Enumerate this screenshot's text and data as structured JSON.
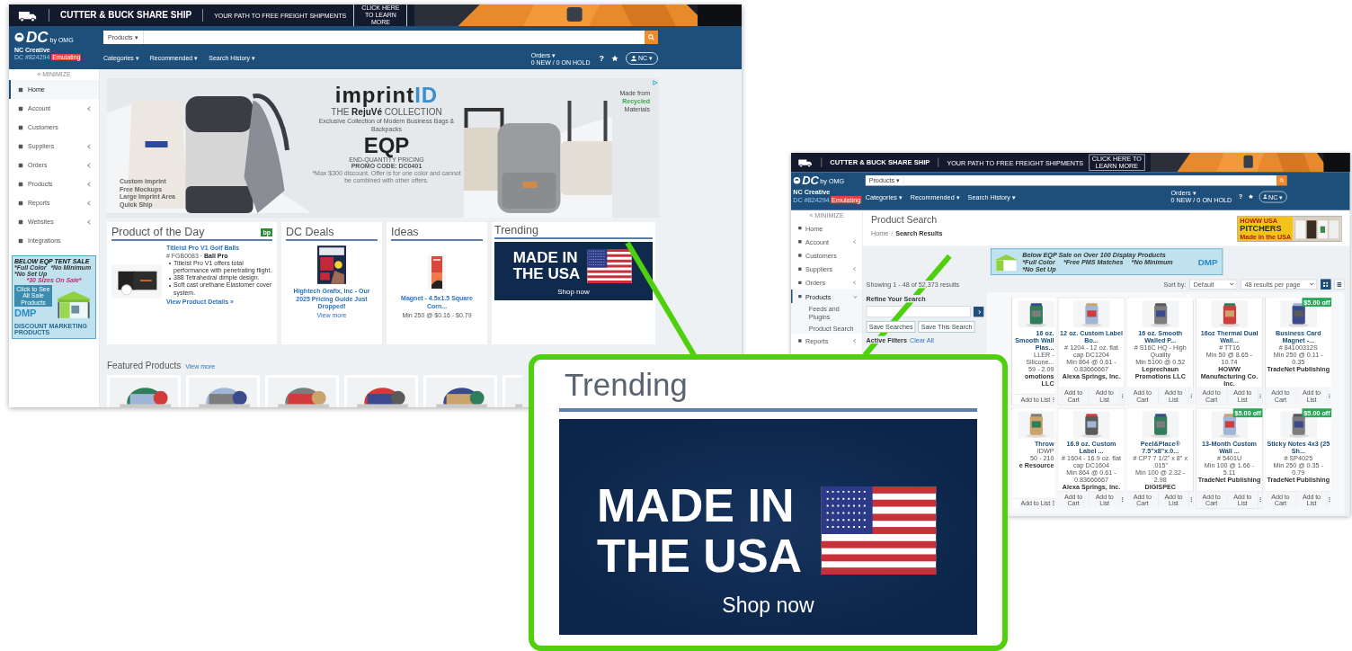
{
  "windows": [
    {
      "kind": "dashboard",
      "promo": {
        "title": "CUTTER & BUCK SHARE SHIP",
        "tagline": "YOUR PATH TO FREE FREIGHT SHIPMENTS",
        "button": "CLICK HERE TO LEARN MORE"
      },
      "header": {
        "logo": "DC",
        "logo_suffix": "by OMG",
        "company": "NC Creative",
        "account": "DC #824294",
        "badge": "Emulating",
        "search_scope": "Products ▾",
        "nav": [
          "Categories ▾",
          "Recommended ▾",
          "Search History ▾"
        ],
        "orders": "Orders ▾",
        "orders_status": "0 NEW / 0 ON HOLD",
        "help": "?",
        "user": "NC ▾"
      },
      "sidebar": {
        "minimize": "« MINIMIZE",
        "items": [
          {
            "label": "Home",
            "selected": true,
            "expandable": false,
            "expanded": false
          },
          {
            "label": "Account",
            "selected": false,
            "expandable": true,
            "expanded": false
          },
          {
            "label": "Customers",
            "selected": false,
            "expandable": false,
            "expanded": false
          },
          {
            "label": "Suppliers",
            "selected": false,
            "expandable": true,
            "expanded": false
          },
          {
            "label": "Orders",
            "selected": false,
            "expandable": true,
            "expanded": false
          },
          {
            "label": "Products",
            "selected": false,
            "expandable": true,
            "expanded": false
          },
          {
            "label": "Reports",
            "selected": false,
            "expandable": true,
            "expanded": false
          },
          {
            "label": "Websites",
            "selected": false,
            "expandable": true,
            "expanded": false
          },
          {
            "label": "Integrations",
            "selected": false,
            "expandable": false,
            "expanded": false
          }
        ],
        "ad": {
          "title": "BELOW EQP TENT SALE",
          "features": [
            "*Full Color",
            "*No Minimum",
            "*No Set Up"
          ],
          "highlight": "*30 Sizes On Sale*",
          "button": "Click to See All Sale Products",
          "brand": "DMP",
          "brand_full": "DISCOUNT MARKETING PRODUCTS"
        }
      },
      "hero": {
        "features": [
          "Custom Imprint",
          "Free Mockups",
          "Large Imprint Area",
          "Quick Ship"
        ],
        "brand": "imprint",
        "brand_mark": "ID",
        "collection": "THE **RejuVé** COLLECTION",
        "tagline": "Exclusive Collection of Modern Business Bags & Backpacks",
        "eqp": "EQP",
        "pricing": "END-QUANTITY PRICING",
        "promo": "PROMO CODE: DC0401",
        "fine_print": "*Max $300 discount. Offer is for one color and cannot be combined with other offers.",
        "recycled": "Made from **Recycled** Materials"
      },
      "potd": {
        "title": "Product of the Day",
        "badge": "bp",
        "product": "Titleist Pro V1 Golf Balls",
        "sku": "# FGB0083 · **Ball Pro**",
        "bullets": [
          "Titleist Pro V1 offers total performance with penetrating flight.",
          "388 Tetrahedral dimple design.",
          "Soft cast urethane Elastomer cover system."
        ],
        "link": "View Product Details »"
      },
      "deals": {
        "title": "DC Deals",
        "link": "Hightech Grafix, Inc - Our 2025 Pricing Guide Just Dropped!",
        "more": "View more"
      },
      "ideas": {
        "title": "Ideas",
        "product": "Magnet - 4.5x1.5 Square Corn...",
        "price": "Min 250 @ $0.16 - $0.79"
      },
      "trending": {
        "title": "Trending",
        "headline": [
          "MADE IN",
          "THE USA"
        ],
        "cta": "Shop now"
      },
      "featured": {
        "title": "Featured Products",
        "link": "View more",
        "cards": [
          {
            "kind": "picture"
          },
          {
            "kind": "picture"
          },
          {
            "kind": "picture"
          },
          {
            "kind": "picture"
          },
          {
            "kind": "picture"
          },
          {
            "kind": "clipped"
          }
        ]
      }
    },
    {
      "kind": "search",
      "promo": {
        "title": "CUTTER & BUCK SHARE SHIP",
        "tagline": "YOUR PATH TO FREE FREIGHT SHIPMENTS",
        "button": "CLICK HERE TO LEARN MORE"
      },
      "header": {
        "logo": "DC",
        "logo_suffix": "by OMG",
        "company": "NC Creative",
        "account": "DC #824294",
        "badge": "Emulating",
        "search_scope": "Products ▾",
        "nav": [
          "Categories ▾",
          "Recommended ▾",
          "Search History ▾"
        ],
        "orders": "Orders ▾",
        "orders_status": "0 NEW / 0 ON HOLD",
        "help": "?",
        "user": "NC ▾"
      },
      "sidebar": {
        "minimize": "« MINIMIZE",
        "items": [
          {
            "label": "Home",
            "selected": false,
            "expandable": false,
            "expanded": false
          },
          {
            "label": "Account",
            "selected": false,
            "expandable": true,
            "expanded": false
          },
          {
            "label": "Customers",
            "selected": false,
            "expandable": false,
            "expanded": false
          },
          {
            "label": "Suppliers",
            "selected": false,
            "expandable": true,
            "expanded": false
          },
          {
            "label": "Orders",
            "selected": false,
            "expandable": true,
            "expanded": false
          },
          {
            "label": "Products",
            "selected": true,
            "expandable": true,
            "expanded": true,
            "children": [
              "Feeds and Plugins",
              "Product Search"
            ]
          },
          {
            "label": "Reports",
            "selected": false,
            "expandable": true,
            "expanded": false
          }
        ]
      },
      "page": {
        "title": "Product Search",
        "breadcrumb": [
          "Home",
          "Search Results"
        ],
        "breadcrumb_separator": "/"
      },
      "top_ad": {
        "lines": [
          "HOWW USA",
          "PITCHERS",
          "Made in the USA"
        ]
      },
      "center_ad": {
        "title": "Below EQP Sale on Over 100 Display Products",
        "features": [
          "*Full Color",
          "*Free PMS Matches",
          "*No Minimum",
          "*No Set Up"
        ],
        "brand": "DMP"
      },
      "results": {
        "count": "Showing 1 - 48 of 52,373 results",
        "sort_label": "Sort by:",
        "sort": "Default",
        "per_page": "48 results per page",
        "views": [
          {
            "kind": "grid",
            "selected": true
          },
          {
            "kind": "list",
            "selected": false
          }
        ]
      },
      "refine": {
        "title": "Refine Your Search",
        "buttons": [
          "Save Searches",
          "Save This Search"
        ],
        "filters": "Active Filters",
        "clear": "Clear All"
      },
      "products": [
        {
          "kind": "clipped",
          "title": "16 oz. Smooth Wall Plas...",
          "lines": [
            "LLER - Silicone...",
            "59 - 2.09",
            "omotions LLC"
          ],
          "actions": [
            "Add to List"
          ]
        },
        {
          "kind": "full",
          "title": "12 oz. Custom Label Bo...",
          "lines": [
            "# 1204 - 12 oz. flat cap DC1204",
            "Min 864 @ 0.61 - 0.83666667",
            "Alexa Springs, Inc."
          ],
          "actions": [
            "Add to Cart",
            "Add to List"
          ]
        },
        {
          "kind": "full",
          "title": "16 oz. Smooth Walled P...",
          "lines": [
            "# S16C HQ - High Quality",
            "Min 5100 @ 0.52",
            "Leprechaun Promotions LLC"
          ],
          "actions": [
            "Add to Cart",
            "Add to List"
          ]
        },
        {
          "kind": "full",
          "title": "16oz Thermal Dual Wall...",
          "lines": [
            "# TT16",
            "Min 50 @ 8.65 - 10.74",
            "HOWW Manufacturing Co. Inc."
          ],
          "actions": [
            "Add to Cart",
            "Add to List"
          ]
        },
        {
          "kind": "full",
          "title": "Business Card Magnet -...",
          "lines": [
            "# 84100312S",
            "Min 250 @ 0.11 - 0.35",
            "TradeNet Publishing"
          ],
          "actions": [
            "Add to Cart",
            "Add to List"
          ],
          "discount": "$5.00 off"
        },
        {
          "kind": "clipped",
          "title": "Throw",
          "lines": [
            "IDWP",
            "50 - 210",
            "e Resource"
          ],
          "actions": [
            "Add to List"
          ]
        },
        {
          "kind": "full",
          "title": "16.9 oz. Custom Label ...",
          "lines": [
            "# 1604 - 16.9 oz. flat cap DC1604",
            "Min 864 @ 0.61 - 0.83666667",
            "Alexa Springs, Inc."
          ],
          "actions": [
            "Add to Cart",
            "Add to List"
          ]
        },
        {
          "kind": "full",
          "title": "Peel&Place® 7.5\"x8\"x.0...",
          "lines": [
            "# CP7 7 1/2\" x 8\" x .015\"",
            "Min 100 @ 2.32 - 2.98",
            "DIGISPEC"
          ],
          "actions": [
            "Add to Cart",
            "Add to List"
          ]
        },
        {
          "kind": "full",
          "title": "13-Month Custom Wall ...",
          "lines": [
            "# 5401U",
            "Min 100 @ 1.66 - 5.11",
            "TradeNet Publishing"
          ],
          "actions": [
            "Add to Cart",
            "Add to List"
          ],
          "discount": "$5.00 off"
        },
        {
          "kind": "full",
          "title": "Sticky Notes 4x3 (25 Sh...",
          "lines": [
            "# SP4025",
            "Min 250 @ 0.35 - 0.79",
            "TradeNet Publishing"
          ],
          "actions": [
            "Add to Cart",
            "Add to List"
          ],
          "discount": "$5.00 off"
        }
      ]
    }
  ],
  "callout": {
    "title": "Trending",
    "headline": [
      "MADE IN",
      "THE USA"
    ],
    "cta": "Shop now"
  }
}
